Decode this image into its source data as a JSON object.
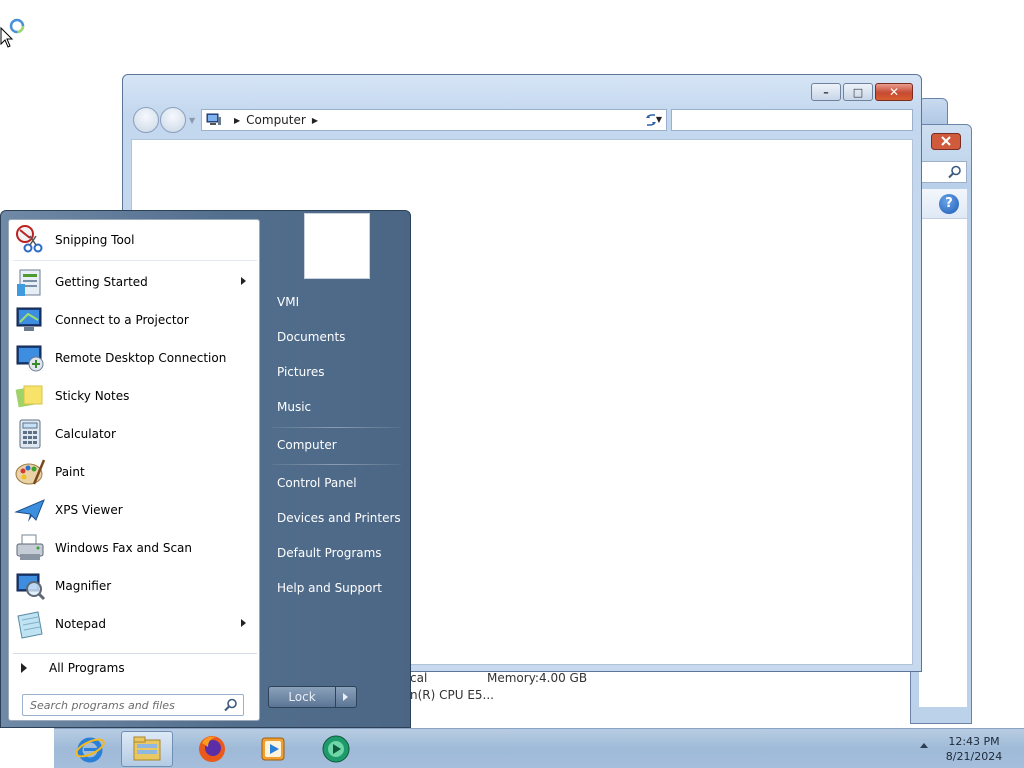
{
  "explorer": {
    "address_segments": [
      "Computer"
    ],
    "search_placeholder": "",
    "caption_min": "–",
    "caption_max": "□",
    "caption_close": "✕"
  },
  "details_pane": {
    "text_1": "cal",
    "memory_label": "Memory:",
    "memory_value": "4.00 GB",
    "cpu_text": "n(R) CPU E5..."
  },
  "start_menu": {
    "pinned": [
      {
        "label": "Snipping Tool",
        "icon": "scissors-icon",
        "submenu": false
      }
    ],
    "recent": [
      {
        "label": "Getting Started",
        "icon": "getting-started-icon",
        "submenu": true
      },
      {
        "label": "Connect to a Projector",
        "icon": "projector-icon",
        "submenu": false
      },
      {
        "label": "Remote Desktop Connection",
        "icon": "remote-desktop-icon",
        "submenu": false
      },
      {
        "label": "Sticky Notes",
        "icon": "sticky-notes-icon",
        "submenu": false
      },
      {
        "label": "Calculator",
        "icon": "calculator-icon",
        "submenu": false
      },
      {
        "label": "Paint",
        "icon": "paint-palette-icon",
        "submenu": false
      },
      {
        "label": "XPS Viewer",
        "icon": "xps-viewer-icon",
        "submenu": false
      },
      {
        "label": "Windows Fax and Scan",
        "icon": "fax-icon",
        "submenu": false
      },
      {
        "label": "Magnifier",
        "icon": "magnifier-icon",
        "submenu": false
      },
      {
        "label": "Notepad",
        "icon": "notepad-icon",
        "submenu": true
      }
    ],
    "all_programs": "All Programs",
    "search_placeholder": "Search programs and files",
    "right_items": [
      {
        "label": "VMI"
      },
      {
        "label": "Documents"
      },
      {
        "label": "Pictures"
      },
      {
        "label": "Music"
      },
      {
        "label": "Computer"
      },
      {
        "label": "Control Panel"
      },
      {
        "label": "Devices and Printers"
      },
      {
        "label": "Default Programs"
      },
      {
        "label": "Help and Support"
      }
    ],
    "lock_label": "Lock"
  },
  "taskbar": {
    "apps": [
      {
        "name": "internet-explorer-icon",
        "active": false
      },
      {
        "name": "file-explorer-icon",
        "active": true
      },
      {
        "name": "firefox-icon",
        "active": false
      },
      {
        "name": "media-player-icon",
        "active": false
      },
      {
        "name": "green-circle-app-icon",
        "active": false
      }
    ],
    "time": "12:43 PM",
    "date": "8/21/2024"
  },
  "colors": {
    "start_menu_panel": "#536f8e",
    "taskbar": "#a4bedb",
    "close_button": "#c64a32"
  }
}
